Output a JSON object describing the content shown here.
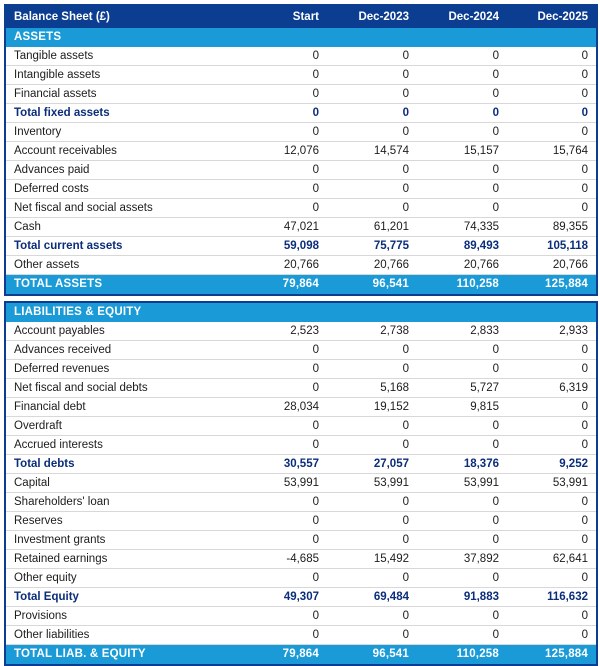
{
  "title": "Balance Sheet (£)",
  "columns": [
    "Start",
    "Dec-2023",
    "Dec-2024",
    "Dec-2025"
  ],
  "colors": {
    "header_blue": "#0b3d91",
    "band_cyan": "#1a9ad6",
    "subtotal_navy": "#0b2d7a",
    "text_dark": "#1c1c1c"
  },
  "sections": [
    {
      "name": "ASSETS",
      "rows": [
        {
          "label": "Tangible assets",
          "style": "data",
          "values": [
            "0",
            "0",
            "0",
            "0"
          ]
        },
        {
          "label": "Intangible assets",
          "style": "data",
          "values": [
            "0",
            "0",
            "0",
            "0"
          ]
        },
        {
          "label": "Financial assets",
          "style": "data",
          "values": [
            "0",
            "0",
            "0",
            "0"
          ]
        },
        {
          "label": "Total fixed assets",
          "style": "subtotal",
          "values": [
            "0",
            "0",
            "0",
            "0"
          ]
        },
        {
          "label": "Inventory",
          "style": "data",
          "values": [
            "0",
            "0",
            "0",
            "0"
          ]
        },
        {
          "label": "Account receivables",
          "style": "data",
          "values": [
            "12,076",
            "14,574",
            "15,157",
            "15,764"
          ]
        },
        {
          "label": "Advances paid",
          "style": "data",
          "values": [
            "0",
            "0",
            "0",
            "0"
          ]
        },
        {
          "label": "Deferred costs",
          "style": "data",
          "values": [
            "0",
            "0",
            "0",
            "0"
          ]
        },
        {
          "label": "Net fiscal and social assets",
          "style": "data",
          "values": [
            "0",
            "0",
            "0",
            "0"
          ]
        },
        {
          "label": "Cash",
          "style": "data",
          "values": [
            "47,021",
            "61,201",
            "74,335",
            "89,355"
          ]
        },
        {
          "label": "Total current assets",
          "style": "subtotal",
          "values": [
            "59,098",
            "75,775",
            "89,493",
            "105,118"
          ]
        },
        {
          "label": "Other assets",
          "style": "data",
          "values": [
            "20,766",
            "20,766",
            "20,766",
            "20,766"
          ]
        }
      ],
      "total": {
        "label": "TOTAL ASSETS",
        "values": [
          "79,864",
          "96,541",
          "110,258",
          "125,884"
        ]
      }
    },
    {
      "name": "LIABILITIES & EQUITY",
      "rows": [
        {
          "label": "Account payables",
          "style": "data",
          "values": [
            "2,523",
            "2,738",
            "2,833",
            "2,933"
          ]
        },
        {
          "label": "Advances received",
          "style": "data",
          "values": [
            "0",
            "0",
            "0",
            "0"
          ]
        },
        {
          "label": "Deferred revenues",
          "style": "data",
          "values": [
            "0",
            "0",
            "0",
            "0"
          ]
        },
        {
          "label": "Net fiscal and social debts",
          "style": "data",
          "values": [
            "0",
            "5,168",
            "5,727",
            "6,319"
          ]
        },
        {
          "label": "Financial debt",
          "style": "data",
          "values": [
            "28,034",
            "19,152",
            "9,815",
            "0"
          ]
        },
        {
          "label": "Overdraft",
          "style": "data",
          "values": [
            "0",
            "0",
            "0",
            "0"
          ]
        },
        {
          "label": "Accrued interests",
          "style": "data",
          "values": [
            "0",
            "0",
            "0",
            "0"
          ]
        },
        {
          "label": "Total debts",
          "style": "subtotal",
          "values": [
            "30,557",
            "27,057",
            "18,376",
            "9,252"
          ]
        },
        {
          "label": "Capital",
          "style": "data",
          "values": [
            "53,991",
            "53,991",
            "53,991",
            "53,991"
          ]
        },
        {
          "label": "Shareholders' loan",
          "style": "data",
          "values": [
            "0",
            "0",
            "0",
            "0"
          ]
        },
        {
          "label": "Reserves",
          "style": "data",
          "values": [
            "0",
            "0",
            "0",
            "0"
          ]
        },
        {
          "label": "Investment grants",
          "style": "data",
          "values": [
            "0",
            "0",
            "0",
            "0"
          ]
        },
        {
          "label": "Retained earnings",
          "style": "data",
          "values": [
            "-4,685",
            "15,492",
            "37,892",
            "62,641"
          ]
        },
        {
          "label": "Other equity",
          "style": "data",
          "values": [
            "0",
            "0",
            "0",
            "0"
          ]
        },
        {
          "label": "Total Equity",
          "style": "subtotal",
          "values": [
            "49,307",
            "69,484",
            "91,883",
            "116,632"
          ]
        },
        {
          "label": "Provisions",
          "style": "data",
          "values": [
            "0",
            "0",
            "0",
            "0"
          ]
        },
        {
          "label": "Other liabilities",
          "style": "data",
          "values": [
            "0",
            "0",
            "0",
            "0"
          ]
        }
      ],
      "total": {
        "label": "TOTAL LIAB. & EQUITY",
        "values": [
          "79,864",
          "96,541",
          "110,258",
          "125,884"
        ]
      }
    }
  ]
}
